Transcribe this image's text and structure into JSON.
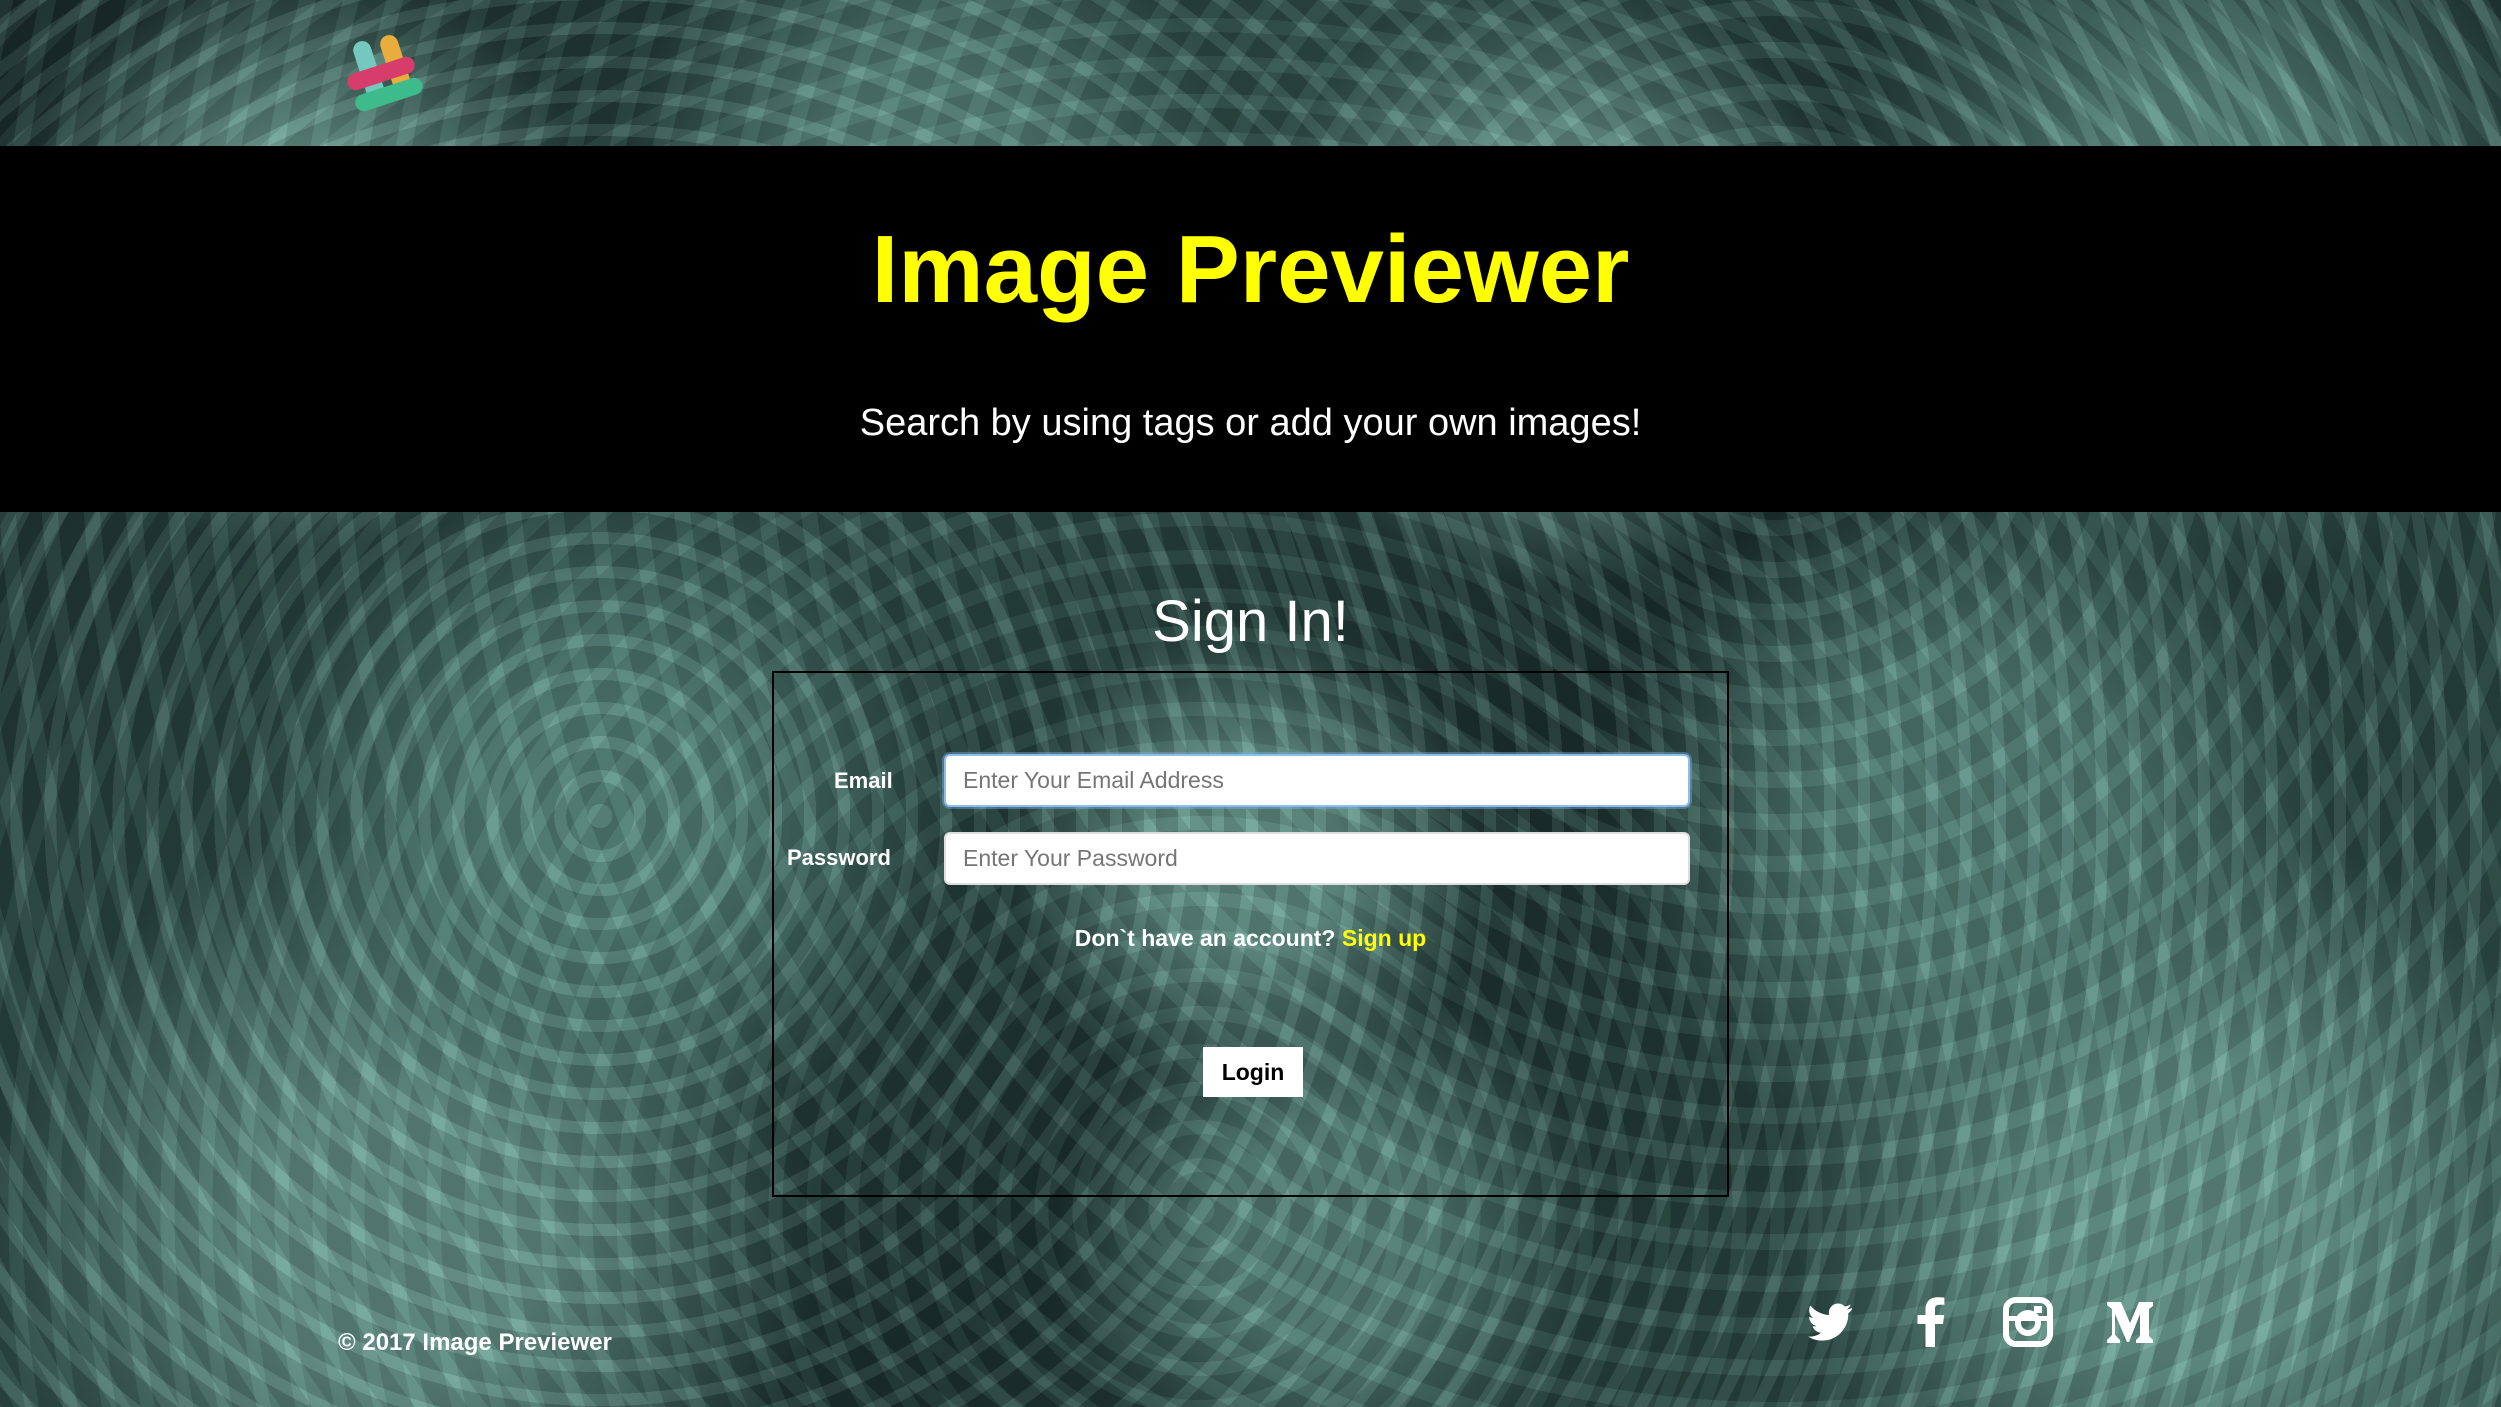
{
  "hero": {
    "title": "Image Previewer",
    "subtitle": "Search by using tags or add your own images!"
  },
  "signin": {
    "title": "Sign In!",
    "email_label": "Email",
    "email_placeholder": "Enter Your Email Address",
    "password_label": "Password",
    "password_placeholder": "Enter Your Password",
    "account_prompt": "Don`t have an account?",
    "signup_link": "Sign up",
    "login_button": "Login"
  },
  "footer": {
    "copyright": "© 2017 Image Previewer",
    "social_icons": [
      "twitter-icon",
      "facebook-icon",
      "instagram-icon",
      "medium-icon"
    ]
  },
  "colors": {
    "hero_background": "#000000",
    "title": "#ffff00",
    "text": "#ffffff",
    "link": "#ffff00"
  }
}
